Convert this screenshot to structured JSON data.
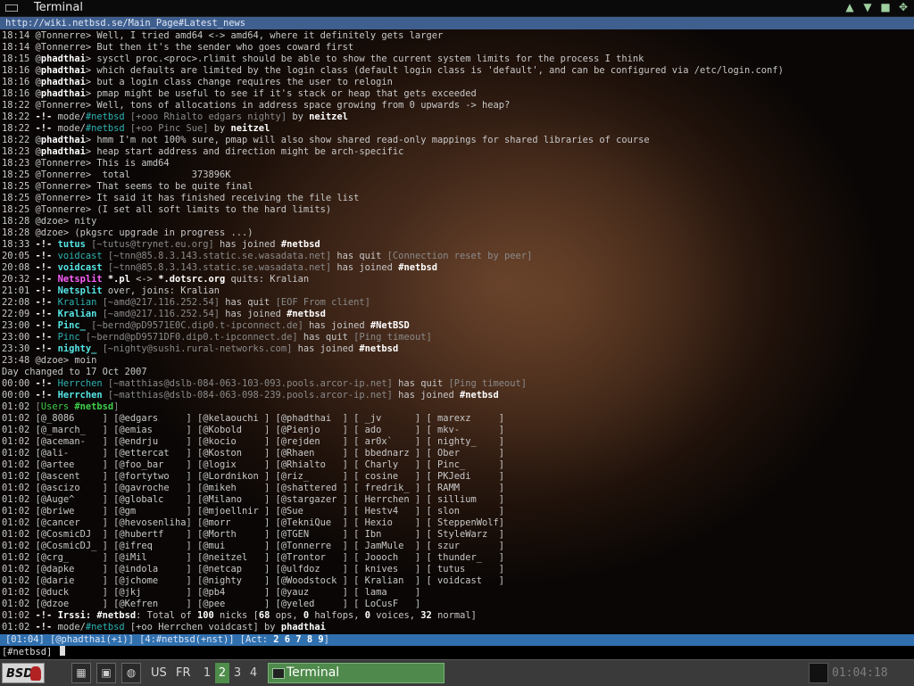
{
  "window": {
    "title": "Terminal",
    "controls": [
      "▲",
      "▼",
      "■",
      "✥"
    ]
  },
  "terminal": {
    "topic_url": "http://wiki.netbsd.se/Main_Page#Latest_news",
    "lines": [
      [
        [
          "ts",
          "18:14 "
        ],
        [
          "",
          "@Tonnerre> Well, I tried amd64 <-> amd64, where it definitely gets larger"
        ]
      ],
      [
        [
          "ts",
          "18:14 "
        ],
        [
          "",
          "@Tonnerre> But then it's the sender who goes coward first"
        ]
      ],
      [
        [
          "ts",
          "18:15 "
        ],
        [
          "",
          "@"
        ],
        [
          "nick",
          "phadthai"
        ],
        [
          "",
          "> sysctl proc.<proc>.rlimit should be able to show the current system limits for the process I think"
        ]
      ],
      [
        [
          "ts",
          "18:16 "
        ],
        [
          "",
          "@"
        ],
        [
          "nick",
          "phadthai"
        ],
        [
          "",
          "> which defaults are limited by the login class (default login class is 'default', and can be configured via /etc/login.conf)"
        ]
      ],
      [
        [
          "ts",
          "18:16 "
        ],
        [
          "",
          "@"
        ],
        [
          "nick",
          "phadthai"
        ],
        [
          "",
          "> but a login class change requires the user to relogin"
        ]
      ],
      [
        [
          "ts",
          "18:16 "
        ],
        [
          "",
          "@"
        ],
        [
          "nick",
          "phadthai"
        ],
        [
          "",
          "> pmap might be useful to see if it's stack or heap that gets exceeded"
        ]
      ],
      [
        [
          "ts",
          "18:22 "
        ],
        [
          "",
          "@Tonnerre> Well, tons of allocations in address space growing from 0 upwards -> heap?"
        ]
      ],
      [
        [
          "ts",
          "18:22 "
        ],
        [
          "bold",
          "-!- "
        ],
        [
          "",
          "mode/"
        ],
        [
          "cy",
          "#netbsd"
        ],
        [
          "dim",
          " [+ooo Rhialto edgars nighty]"
        ],
        [
          "",
          " by "
        ],
        [
          "bold",
          "neitzel"
        ]
      ],
      [
        [
          "ts",
          "18:22 "
        ],
        [
          "bold",
          "-!- "
        ],
        [
          "",
          "mode/"
        ],
        [
          "cy",
          "#netbsd"
        ],
        [
          "dim",
          " [+oo Pinc Sue]"
        ],
        [
          "",
          " by "
        ],
        [
          "bold",
          "neitzel"
        ]
      ],
      [
        [
          "ts",
          "18:22 "
        ],
        [
          "",
          "@"
        ],
        [
          "nick",
          "phadthai"
        ],
        [
          "",
          "> hmm I'm not 100% sure, pmap will also show shared read-only mappings for shared libraries of course"
        ]
      ],
      [
        [
          "ts",
          "18:23 "
        ],
        [
          "",
          "@"
        ],
        [
          "nick",
          "phadthai"
        ],
        [
          "",
          "> heap start address and direction might be arch-specific"
        ]
      ],
      [
        [
          "ts",
          "18:23 "
        ],
        [
          "",
          "@Tonnerre> This is amd64"
        ]
      ],
      [
        [
          "ts",
          "18:25 "
        ],
        [
          "",
          "@Tonnerre>  total           373896K"
        ]
      ],
      [
        [
          "ts",
          "18:25 "
        ],
        [
          "",
          "@Tonnerre> That seems to be quite final"
        ]
      ],
      [
        [
          "ts",
          "18:25 "
        ],
        [
          "",
          "@Tonnerre> It said it has finished receiving the file list"
        ]
      ],
      [
        [
          "ts",
          "18:25 "
        ],
        [
          "",
          "@Tonnerre> (I set all soft limits to the hard limits)"
        ]
      ],
      [
        [
          "ts",
          "18:28 "
        ],
        [
          "",
          "@dzoe> nity"
        ]
      ],
      [
        [
          "ts",
          "18:28 "
        ],
        [
          "",
          "@dzoe> (pkgsrc upgrade in progress ...)"
        ]
      ],
      [
        [
          "ts",
          "18:33 "
        ],
        [
          "bold",
          "-!- "
        ],
        [
          "cyb",
          "tutus"
        ],
        [
          "dim",
          " [~tutus@trynet.eu.org]"
        ],
        [
          "",
          " has joined "
        ],
        [
          "bold",
          "#netbsd"
        ]
      ],
      [
        [
          "ts",
          "20:05 "
        ],
        [
          "bold",
          "-!- "
        ],
        [
          "cy",
          "voidcast"
        ],
        [
          "dim",
          " [~tnn@85.8.3.143.static.se.wasadata.net]"
        ],
        [
          "",
          " has quit "
        ],
        [
          "dim",
          "[Connection reset by peer]"
        ]
      ],
      [
        [
          "ts",
          "20:08 "
        ],
        [
          "bold",
          "-!- "
        ],
        [
          "cyb",
          "voidcast"
        ],
        [
          "dim",
          " [~tnn@85.8.3.143.static.se.wasadata.net]"
        ],
        [
          "",
          " has joined "
        ],
        [
          "bold",
          "#netbsd"
        ]
      ],
      [
        [
          "ts",
          "20:32 "
        ],
        [
          "bold",
          "-!- "
        ],
        [
          "mag",
          "Netsplit"
        ],
        [
          "bold",
          " *.pl"
        ],
        [
          "",
          " <-> "
        ],
        [
          "bold",
          "*.dotsrc.org"
        ],
        [
          "",
          " quits: Kralian"
        ]
      ],
      [
        [
          "ts",
          "21:01 "
        ],
        [
          "bold",
          "-!- "
        ],
        [
          "cyb",
          "Netsplit"
        ],
        [
          "",
          " over, joins: Kralian"
        ]
      ],
      [
        [
          "ts",
          "22:08 "
        ],
        [
          "bold",
          "-!- "
        ],
        [
          "cy",
          "Kralian"
        ],
        [
          "dim",
          " [~amd@217.116.252.54]"
        ],
        [
          "",
          " has quit "
        ],
        [
          "dim",
          "[EOF From client]"
        ]
      ],
      [
        [
          "ts",
          "22:09 "
        ],
        [
          "bold",
          "-!- "
        ],
        [
          "cyb",
          "Kralian"
        ],
        [
          "dim",
          " [~amd@217.116.252.54]"
        ],
        [
          "",
          " has joined "
        ],
        [
          "bold",
          "#netbsd"
        ]
      ],
      [
        [
          "ts",
          "23:00 "
        ],
        [
          "bold",
          "-!- "
        ],
        [
          "cyb",
          "Pinc_"
        ],
        [
          "dim",
          " [~bernd@pD9571E0C.dip0.t-ipconnect.de]"
        ],
        [
          "",
          " has joined "
        ],
        [
          "bold",
          "#NetBSD"
        ]
      ],
      [
        [
          "ts",
          "23:00 "
        ],
        [
          "bold",
          "-!- "
        ],
        [
          "cy",
          "Pinc"
        ],
        [
          "dim",
          " [~bernd@pD9571DF0.dip0.t-ipconnect.de]"
        ],
        [
          "",
          " has quit "
        ],
        [
          "dim",
          "[Ping timeout]"
        ]
      ],
      [
        [
          "ts",
          "23:30 "
        ],
        [
          "bold",
          "-!- "
        ],
        [
          "cyb",
          "nighty_"
        ],
        [
          "dim",
          " [~nighty@sushi.rural-networks.com]"
        ],
        [
          "",
          " has joined "
        ],
        [
          "bold",
          "#netbsd"
        ]
      ],
      [
        [
          "ts",
          "23:48 "
        ],
        [
          "",
          "@dzoe> moin"
        ]
      ],
      [
        [
          "",
          "Day changed to 17 Oct 2007"
        ]
      ],
      [
        [
          "ts",
          "00:00 "
        ],
        [
          "bold",
          "-!- "
        ],
        [
          "cy",
          "Herrchen"
        ],
        [
          "dim",
          " [~matthias@dslb-084-063-103-093.pools.arcor-ip.net]"
        ],
        [
          "",
          " has quit "
        ],
        [
          "dim",
          "[Ping timeout]"
        ]
      ],
      [
        [
          "ts",
          "00:00 "
        ],
        [
          "bold",
          "-!- "
        ],
        [
          "cyb",
          "Herrchen"
        ],
        [
          "dim",
          " [~matthias@dslb-084-063-098-239.pools.arcor-ip.net]"
        ],
        [
          "",
          " has joined "
        ],
        [
          "bold",
          "#netbsd"
        ]
      ],
      [
        [
          "ts",
          "01:02 "
        ],
        [
          "dim",
          "["
        ],
        [
          "gr",
          "Users "
        ],
        [
          "grn",
          "#netbsd"
        ],
        [
          "dim",
          "]"
        ]
      ],
      [
        [
          "ts",
          "01:02 "
        ],
        [
          "",
          "[@_8086     ] [@edgars     ] [@kelaouchi ] [@phadthai  ] [ _jv      ] [ marexz     ]"
        ]
      ],
      [
        [
          "ts",
          "01:02 "
        ],
        [
          "",
          "[@_march_   ] [@emias      ] [@Kobold    ] [@Pienjo    ] [ ado      ] [ mkv-       ]"
        ]
      ],
      [
        [
          "ts",
          "01:02 "
        ],
        [
          "",
          "[@aceman-   ] [@endrju     ] [@kocio     ] [@rejden    ] [ ar0x`    ] [ nighty_    ]"
        ]
      ],
      [
        [
          "ts",
          "01:02 "
        ],
        [
          "",
          "[@ali-      ] [@ettercat   ] [@Koston    ] [@Rhaen     ] [ bbednarz ] [ Ober       ]"
        ]
      ],
      [
        [
          "ts",
          "01:02 "
        ],
        [
          "",
          "[@artee     ] [@foo_bar    ] [@logix     ] [@Rhialto   ] [ Charly   ] [ Pinc_      ]"
        ]
      ],
      [
        [
          "ts",
          "01:02 "
        ],
        [
          "",
          "[@ascent    ] [@fortytwo   ] [@Lordnikon ] [@riz_      ] [ cosine   ] [ PKJedi     ]"
        ]
      ],
      [
        [
          "ts",
          "01:02 "
        ],
        [
          "",
          "[@ascizo    ] [@gavroche   ] [@mikeh     ] [@shattered ] [ fredrik_ ] [ RAMM       ]"
        ]
      ],
      [
        [
          "ts",
          "01:02 "
        ],
        [
          "",
          "[@Auge^     ] [@globalc    ] [@Milano    ] [@stargazer ] [ Herrchen ] [ sillium    ]"
        ]
      ],
      [
        [
          "ts",
          "01:02 "
        ],
        [
          "",
          "[@briwe     ] [@gm         ] [@mjoellnir ] [@Sue       ] [ Hestv4   ] [ slon       ]"
        ]
      ],
      [
        [
          "ts",
          "01:02 "
        ],
        [
          "",
          "[@cancer    ] [@hevosenliha] [@morr      ] [@TekniQue  ] [ Hexio    ] [ SteppenWolf]"
        ]
      ],
      [
        [
          "ts",
          "01:02 "
        ],
        [
          "",
          "[@CosmicDJ  ] [@hubertf    ] [@Morth     ] [@TGEN      ] [ Ibn      ] [ StyleWarz  ]"
        ]
      ],
      [
        [
          "ts",
          "01:02 "
        ],
        [
          "",
          "[@CosmicDJ_ ] [@ifreq      ] [@mui       ] [@Tonnerre  ] [ JamMule  ] [ szur       ]"
        ]
      ],
      [
        [
          "ts",
          "01:02 "
        ],
        [
          "",
          "[@crg_      ] [@iMil       ] [@neitzel   ] [@Trontor   ] [ Joooch   ] [ thunder_   ]"
        ]
      ],
      [
        [
          "ts",
          "01:02 "
        ],
        [
          "",
          "[@dapke     ] [@indola     ] [@netcap    ] [@ulfdoz    ] [ knives   ] [ tutus      ]"
        ]
      ],
      [
        [
          "ts",
          "01:02 "
        ],
        [
          "",
          "[@darie     ] [@jchome     ] [@nighty    ] [@Woodstock ] [ Kralian  ] [ voidcast   ]"
        ]
      ],
      [
        [
          "ts",
          "01:02 "
        ],
        [
          "",
          "[@duck      ] [@jkj        ] [@pb4       ] [@yauz      ] [ lama     ]"
        ]
      ],
      [
        [
          "ts",
          "01:02 "
        ],
        [
          "",
          "[@dzoe      ] [@Kefren     ] [@pee       ] [@yeled     ] [ LoCusF   ]"
        ]
      ],
      [
        [
          "ts",
          "01:02 "
        ],
        [
          "bold",
          "-!- "
        ],
        [
          "bold",
          "Irssi: "
        ],
        [
          "bold",
          "#netbsd"
        ],
        [
          "",
          ": Total of "
        ],
        [
          "bold",
          "100"
        ],
        [
          "",
          " nicks ["
        ],
        [
          "bold",
          "68"
        ],
        [
          "",
          " ops, "
        ],
        [
          "bold",
          "0"
        ],
        [
          "",
          " halfops, "
        ],
        [
          "bold",
          "0"
        ],
        [
          "",
          " voices, "
        ],
        [
          "bold",
          "32"
        ],
        [
          "",
          " normal]"
        ]
      ],
      [
        [
          "ts",
          "01:02 "
        ],
        [
          "bold",
          "-!- "
        ],
        [
          "",
          "mode/"
        ],
        [
          "cy",
          "#netbsd"
        ],
        [
          "",
          " [+oo Herrchen voidcast] by "
        ],
        [
          "bold",
          "phadthai"
        ]
      ]
    ],
    "status_bar": {
      "prefix": "[01:04] [@phadthai(+i)] [4:#netbsd(+nst)] [Act: ",
      "activity": "2 6 7 8 9",
      "suffix": "]"
    },
    "prompt": "[#netbsd] "
  },
  "taskbar": {
    "start_label": "BSD",
    "keyboard_layouts": [
      "US",
      "FR"
    ],
    "workspaces": [
      "1",
      "2",
      "3",
      "4"
    ],
    "active_workspace": "2",
    "task_label": "Terminal",
    "clock": "01:04:18"
  }
}
